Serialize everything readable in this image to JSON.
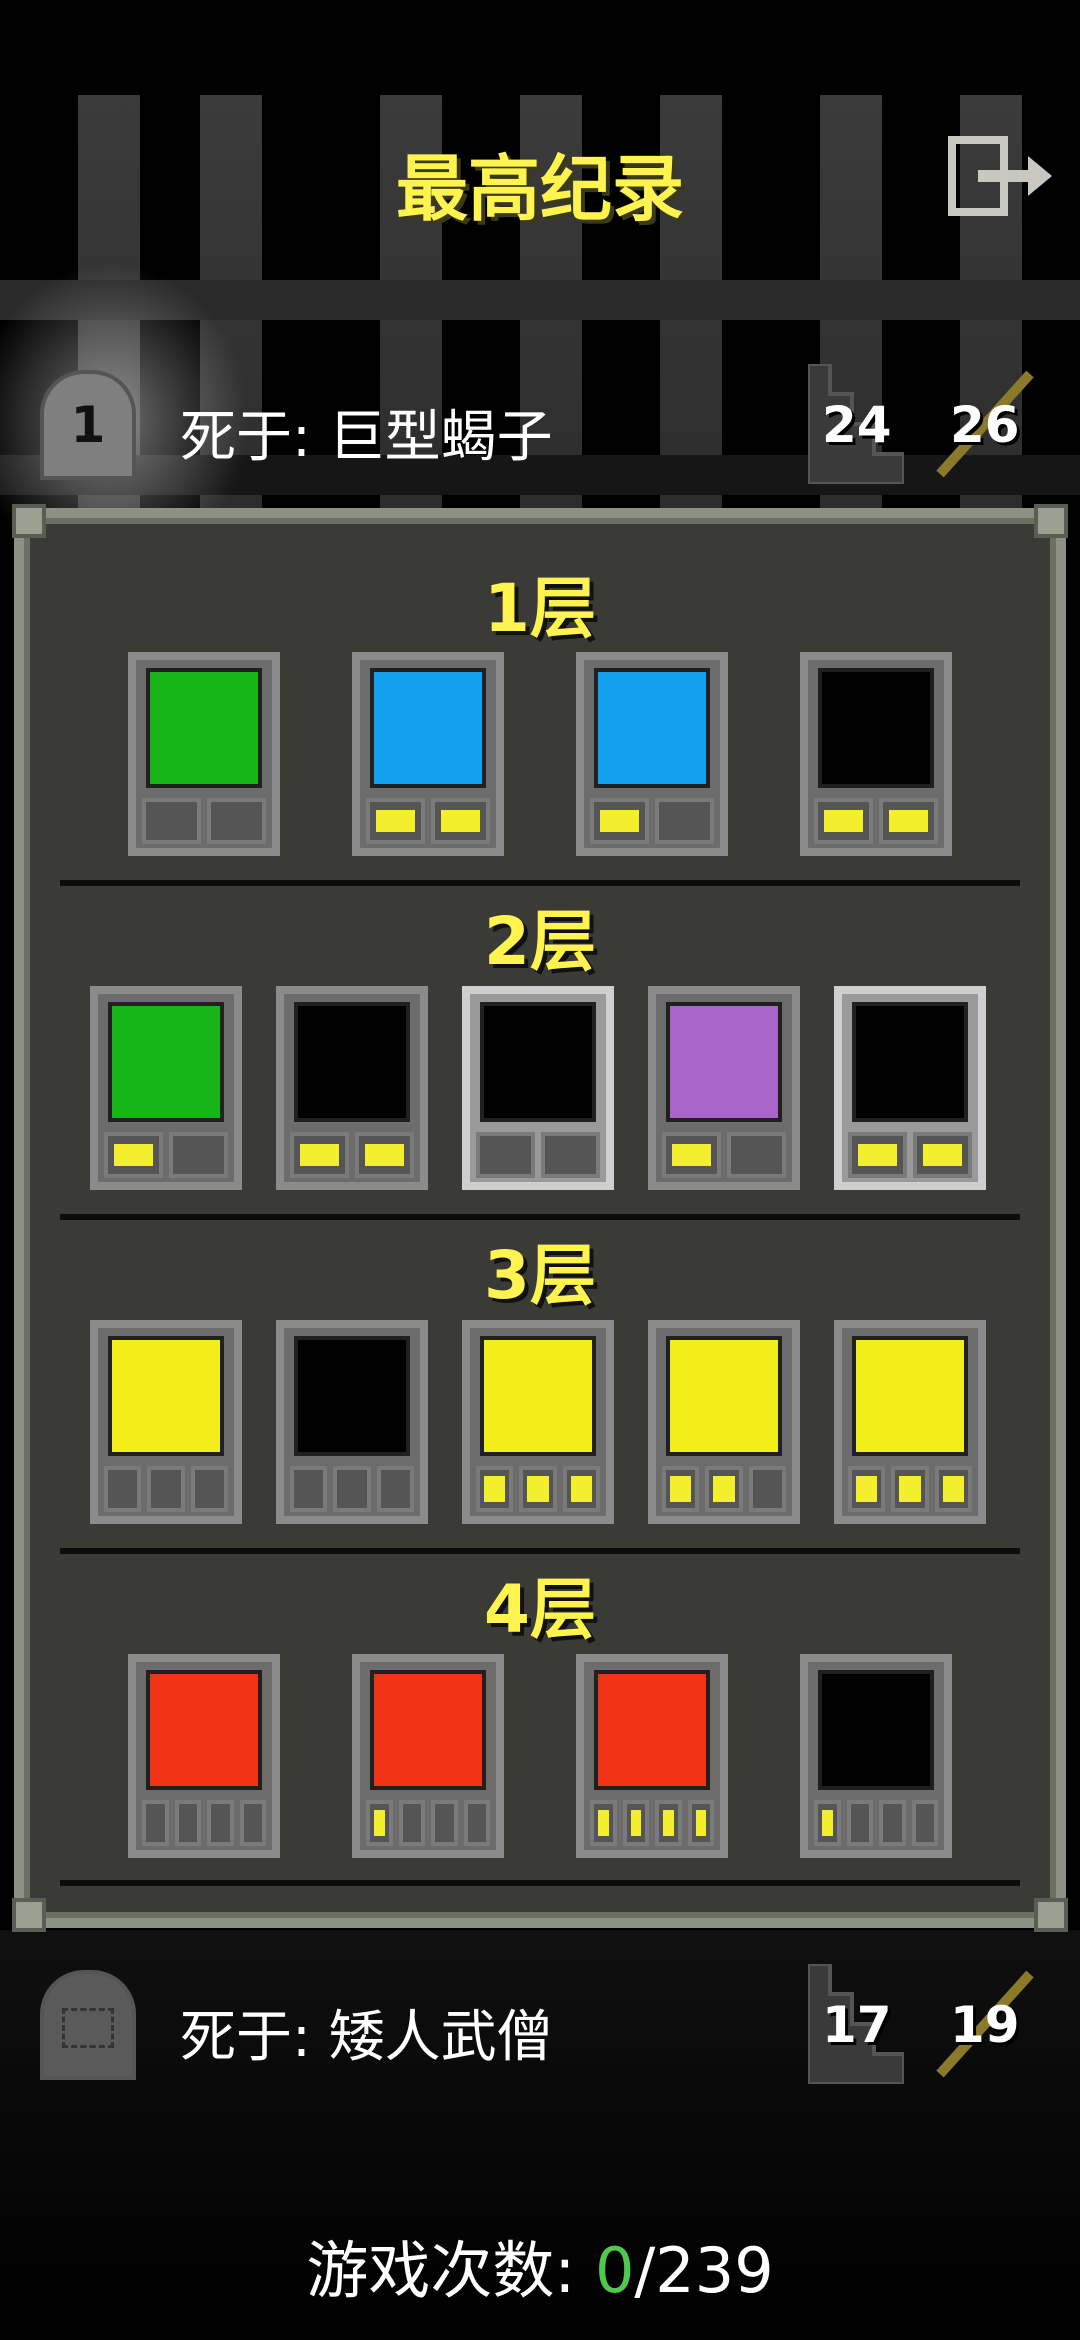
{
  "title": "最高纪录",
  "records": [
    {
      "rank": "1",
      "cause": "死于: 巨型蝎子",
      "depth": "24",
      "level": "26"
    },
    {
      "rank": "",
      "cause": "死于: 矮人武僧",
      "depth": "17",
      "level": "19"
    }
  ],
  "floors": [
    {
      "label": "1层",
      "items": [
        {
          "icon": "white-shield-upgrade-icon",
          "color": "#17b417",
          "slots": [
            0,
            0
          ]
        },
        {
          "icon": "unknown-blue-wand-icon",
          "color": "#14a0f0",
          "slots": [
            1,
            1
          ]
        },
        {
          "icon": "unknown-item-battery-icon",
          "color": "#14a0f0",
          "slots": [
            1,
            0
          ]
        },
        {
          "icon": "yellow-shield-icon",
          "color": "#000000",
          "slots": [
            1,
            1
          ]
        }
      ]
    },
    {
      "label": "2层",
      "items": [
        {
          "icon": "white-shield-battery-icon",
          "color": "#17b417",
          "slots": [
            1,
            0
          ]
        },
        {
          "icon": "full-battery-icon",
          "color": "#000000",
          "slots": [
            1,
            1
          ]
        },
        {
          "icon": "purple-wand-icon",
          "color": "#000000",
          "slots": [
            0,
            0
          ]
        },
        {
          "icon": "purple-wand-pink-icon",
          "color": "#a864c8",
          "slots": [
            1,
            0
          ]
        },
        {
          "icon": "empty-battery-icon",
          "color": "#000000",
          "slots": [
            1,
            1
          ]
        }
      ]
    },
    {
      "label": "3层",
      "items": [
        {
          "icon": "olive-wand-upgrade-icon",
          "color": "#f2ee1a",
          "slots": [
            0,
            0,
            0
          ]
        },
        {
          "icon": "right-arrow-icon",
          "color": "#000000",
          "slots": [
            0,
            0,
            0
          ]
        },
        {
          "icon": "olive-wand-upgrade-icon",
          "color": "#f2ee1a",
          "slots": [
            1,
            1,
            1
          ]
        },
        {
          "icon": "olive-wand-green-battery-icon",
          "color": "#f2ee1a",
          "slots": [
            1,
            1,
            0
          ]
        },
        {
          "icon": "olive-wand-white-battery-icon",
          "color": "#f2ee1a",
          "slots": [
            1,
            1,
            1
          ]
        }
      ]
    },
    {
      "label": "4层",
      "items": [
        {
          "icon": "explosion-signal-icon",
          "color": "#f23214",
          "slots": [
            0,
            0,
            0,
            0
          ]
        },
        {
          "icon": "explosion-upgrade-icon",
          "color": "#f23214",
          "slots": [
            1,
            0,
            0,
            0
          ]
        },
        {
          "icon": "explosion-shield-icon",
          "color": "#f23214",
          "slots": [
            1,
            1,
            1,
            1
          ]
        },
        {
          "icon": "green-bell-icon",
          "color": "#000000",
          "slots": [
            1,
            0,
            0,
            0
          ]
        }
      ]
    }
  ],
  "games": {
    "label": "游戏次数:",
    "wins": "0",
    "total": "/239"
  },
  "colors": {
    "accent": "#fff44f",
    "slot_on": "#f4ef2c",
    "win": "#4ec94e"
  }
}
